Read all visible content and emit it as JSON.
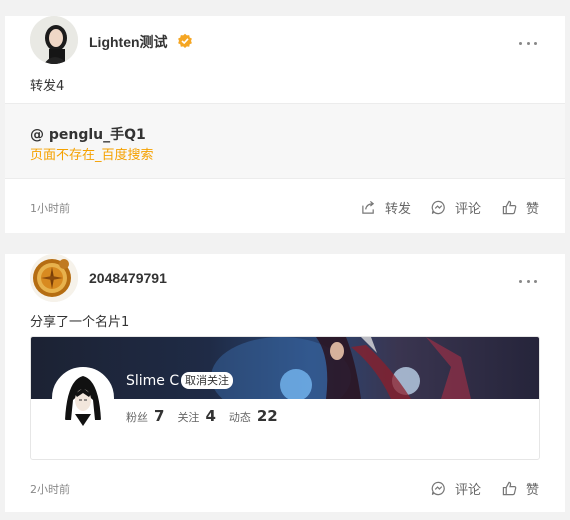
{
  "posts": [
    {
      "username": "Lighten测试",
      "verified": true,
      "content": "转发4",
      "quote": {
        "author": "@ penglu_手Q1",
        "link": "页面不存在_百度搜索"
      },
      "time": "1小时前",
      "actions": {
        "forward": "转发",
        "comment": "评论",
        "like": "赞"
      }
    },
    {
      "username": "2048479791",
      "content": "分享了一个名片1",
      "card": {
        "name": "Slime C",
        "unfollow": "取消关注",
        "fans_label": "粉丝",
        "fans": "7",
        "following_label": "关注",
        "following": "4",
        "posts_label": "动态",
        "posts": "22"
      },
      "time": "2小时前",
      "actions": {
        "comment": "评论",
        "like": "赞"
      }
    }
  ],
  "colors": {
    "accent": "#f5a100",
    "verified_badge": "#f5a623",
    "background": "#f2f2f2"
  },
  "icons": [
    "more-icon",
    "verified-icon",
    "forward-icon",
    "comment-icon",
    "like-icon"
  ]
}
